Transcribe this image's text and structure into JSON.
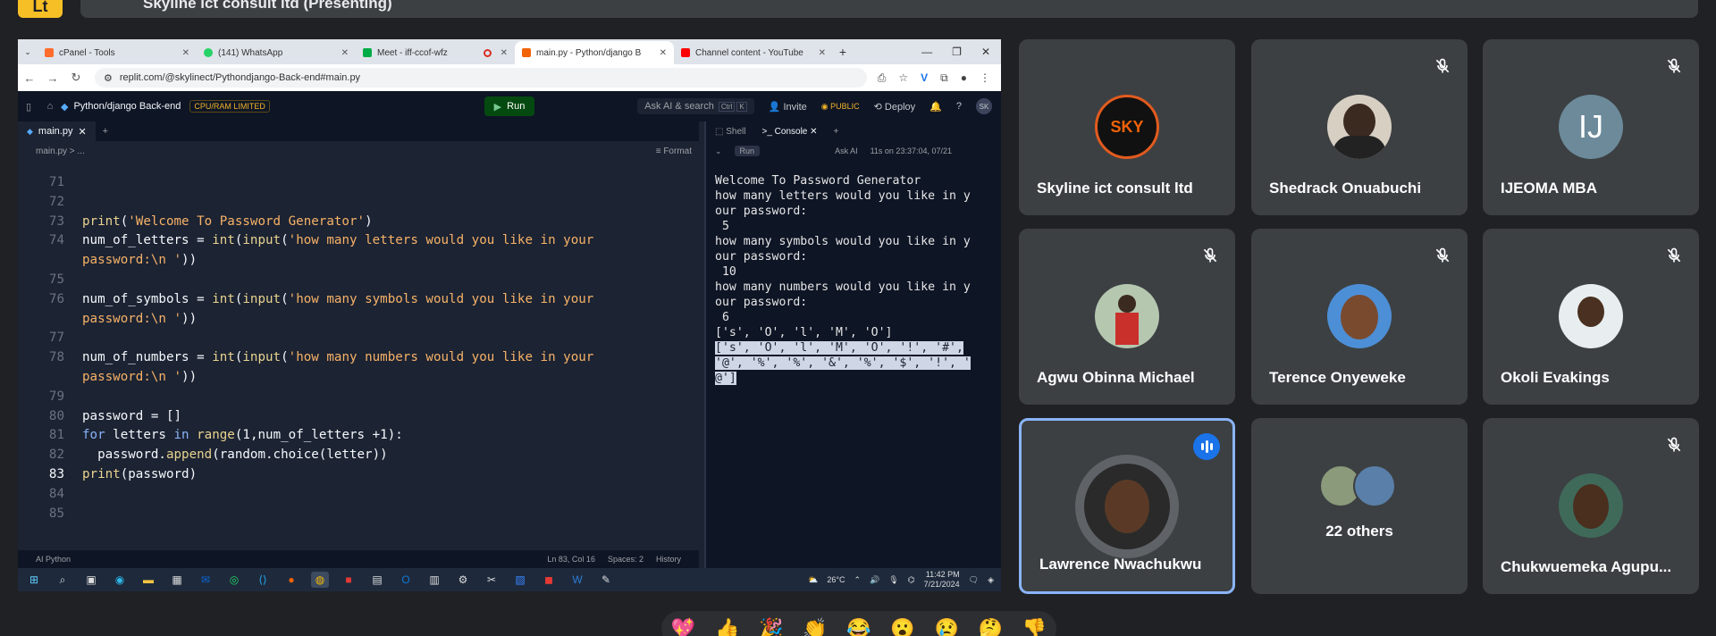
{
  "meet": {
    "presenter_initials": "Lt",
    "presenting_title": "Skyline ict consult ltd (Presenting)"
  },
  "browser": {
    "tabs": [
      {
        "label": "cPanel - Tools",
        "color": "#ff6c2c"
      },
      {
        "label": "(141) WhatsApp",
        "color": "#25d366"
      },
      {
        "label": "Meet - iff-ccof-wfz",
        "color": "#00ac47"
      },
      {
        "label": "main.py - Python/django B",
        "color": "#f26207"
      },
      {
        "label": "Channel content - YouTube",
        "color": "#ff0000"
      }
    ],
    "url": "replit.com/@skylinect/Pythondjango-Back-end#main.py"
  },
  "replit": {
    "repl_name": "Python/django Back-end",
    "cpu_badge": "CPU/RAM LIMITED",
    "run_label": "Run",
    "ask_ai": "Ask AI & search",
    "kbd1": "Ctrl",
    "kbd2": "K",
    "invite": "Invite",
    "public": "PUBLIC",
    "deploy": "Deploy",
    "help": "?",
    "avatar": "SK"
  },
  "editor": {
    "file_tab": "main.py",
    "breadcrumb": "main.py  >  ...",
    "format": "Format",
    "status_left": "AI   Python",
    "status_pos": "Ln 83, Col 16",
    "status_spaces": "Spaces: 2",
    "status_history": "History"
  },
  "console": {
    "tab_shell": "Shell",
    "tab_console": "Console",
    "run": "Run",
    "ask_ai": "Ask AI",
    "timing": "11s on 23:37:04, 07/21",
    "out_1": "Welcome To Password Generator\nhow many letters would you like in y\nour password:\n 5\nhow many symbols would you like in y\nour password:\n 10\nhow many numbers would you like in y\nour password:\n 6\n['s', 'O', 'l', 'M', 'O']",
    "out_sel": "['s', 'O', 'l', 'M', 'O', '!', '#',\n'@', '%', '%', '&', '%', '$', '!', '\n@']"
  },
  "taskbar": {
    "weather": "26°C",
    "time": "11:42 PM",
    "date": "7/21/2024"
  },
  "participants": [
    {
      "name": "Skyline ict consult ltd",
      "muted": false,
      "avatar": "SKY"
    },
    {
      "name": "Shedrack Onuabuchi",
      "muted": true
    },
    {
      "name": "IJEOMA MBA",
      "muted": true,
      "initials": "IJ"
    },
    {
      "name": "Agwu Obinna Michael",
      "muted": true
    },
    {
      "name": "Terence Onyeweke",
      "muted": true
    },
    {
      "name": "Okoli Evakings",
      "muted": true
    },
    {
      "name": "Lawrence Nwachukwu",
      "speaking": true
    },
    {
      "name": "22 others"
    },
    {
      "name": "Chukwuemeka Agupu...",
      "muted": true
    }
  ],
  "reactions": [
    "💖",
    "👍",
    "🎉",
    "👏",
    "😂",
    "😮",
    "😢",
    "🤔",
    "👎"
  ]
}
